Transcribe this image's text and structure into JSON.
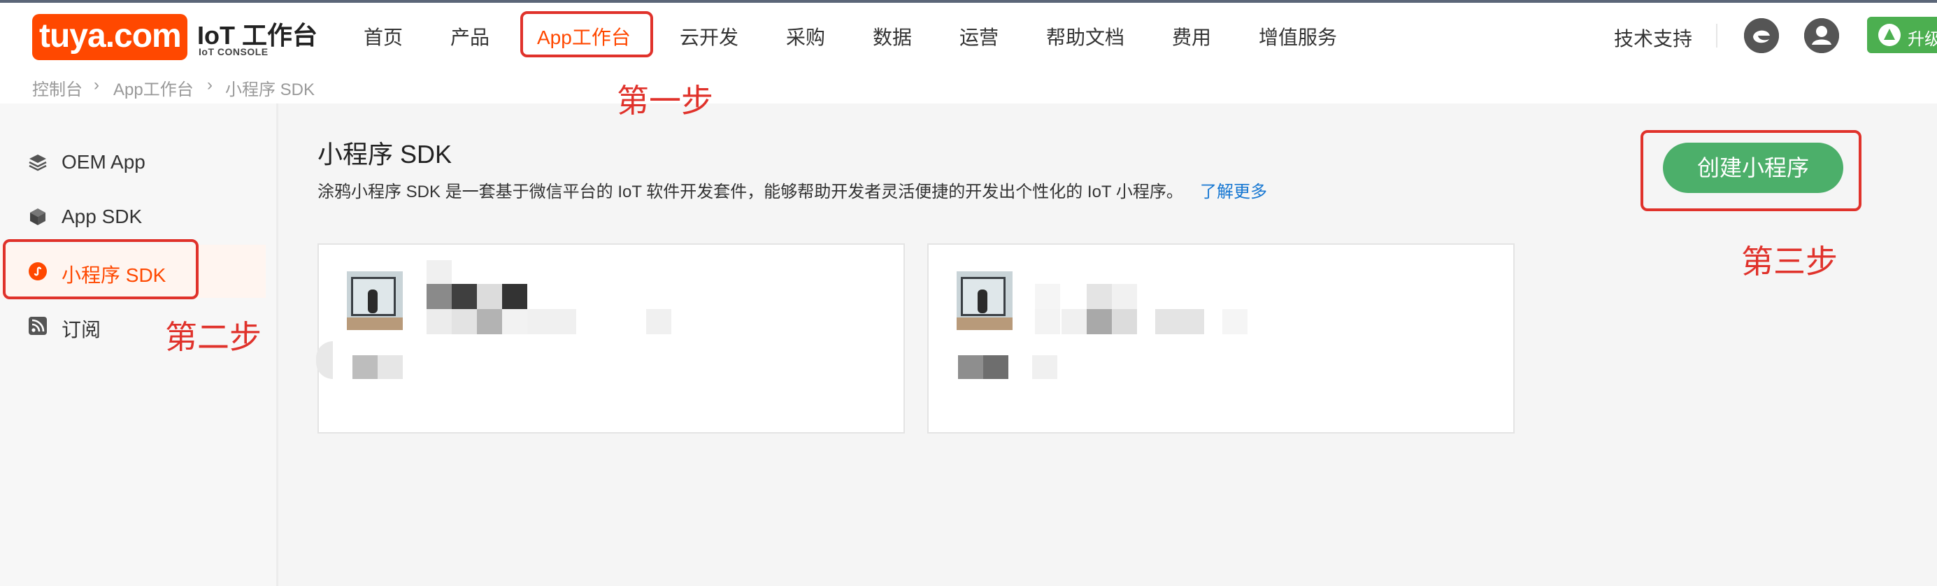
{
  "brand": {
    "logo_text": "tuya.com",
    "title": "IoT 工作台",
    "subtitle": "IoT CONSOLE"
  },
  "nav": {
    "items": [
      "首页",
      "产品",
      "App工作台",
      "云开发",
      "采购",
      "数据",
      "运营",
      "帮助文档",
      "费用",
      "增值服务"
    ],
    "active_index": 2
  },
  "header_right": {
    "tech_support": "技术支持",
    "icons": [
      "edge-browser-icon",
      "user-avatar-icon"
    ],
    "upgrade_label": "升级"
  },
  "breadcrumb": [
    "控制台",
    "App工作台",
    "小程序 SDK"
  ],
  "sidebar": {
    "items": [
      {
        "label": "OEM App",
        "icon": "layers-icon"
      },
      {
        "label": "App SDK",
        "icon": "cube-icon"
      },
      {
        "label": "小程序 SDK",
        "icon": "mini-program-icon"
      },
      {
        "label": "订阅",
        "icon": "rss-icon"
      }
    ],
    "active_index": 2
  },
  "main": {
    "title": "小程序 SDK",
    "description": "涂鸦小程序 SDK 是一套基于微信平台的 IoT 软件开发套件，能够帮助开发者灵活便捷的开发出个性化的 IoT 小程序。",
    "learn_more": "了解更多",
    "create_button": "创建小程序"
  },
  "annotations": {
    "step1": "第一步",
    "step2": "第二步",
    "step3": "第三步",
    "color": "#e0322b"
  },
  "colors": {
    "brand": "#ff4800",
    "primary_button": "#4caf6a",
    "link": "#1677d2"
  }
}
